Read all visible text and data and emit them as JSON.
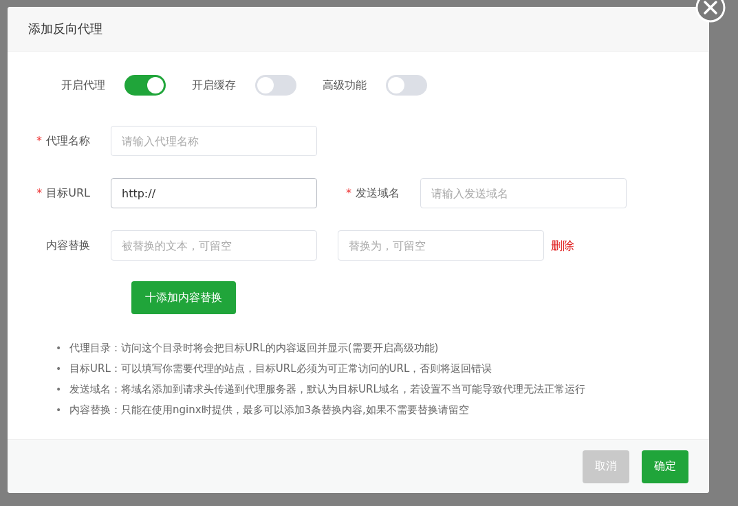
{
  "dialog": {
    "title": "添加反向代理",
    "toggles": [
      {
        "label": "开启代理",
        "on": true
      },
      {
        "label": "开启缓存",
        "on": false
      },
      {
        "label": "高级功能",
        "on": false
      }
    ],
    "name_field": {
      "label": "代理名称",
      "required_mark": "*",
      "placeholder": "请输入代理名称"
    },
    "target_field": {
      "label": "目标URL",
      "required_mark": "*",
      "value": "http://"
    },
    "host_field": {
      "label": "发送域名",
      "required_mark": "*",
      "placeholder": "请输入发送域名"
    },
    "replace": {
      "label": "内容替换",
      "from_placeholder": "被替换的文本，可留空",
      "to_placeholder": "替换为，可留空",
      "delete": "删除",
      "add_button": "十添加内容替换"
    },
    "notes": [
      {
        "bullet": "•",
        "text": "代理目录：访问这个目录时将会把目标URL的内容返回并显示(需要开启高级功能)"
      },
      {
        "bullet": "•",
        "text": "目标URL：可以填写你需要代理的站点，目标URL必须为可正常访问的URL，否则将返回错误"
      },
      {
        "bullet": "•",
        "text": "发送域名：将域名添加到请求头传递到代理服务器，默认为目标URL域名，若设置不当可能导致代理无法正常运行"
      },
      {
        "bullet": "•",
        "text": "内容替换：只能在使用nginx时提供，最多可以添加3条替换内容,如果不需要替换请留空"
      }
    ],
    "buttons": [
      {
        "label": "取消",
        "kind": "cancel"
      },
      {
        "label": "确定",
        "kind": "primary"
      }
    ]
  }
}
